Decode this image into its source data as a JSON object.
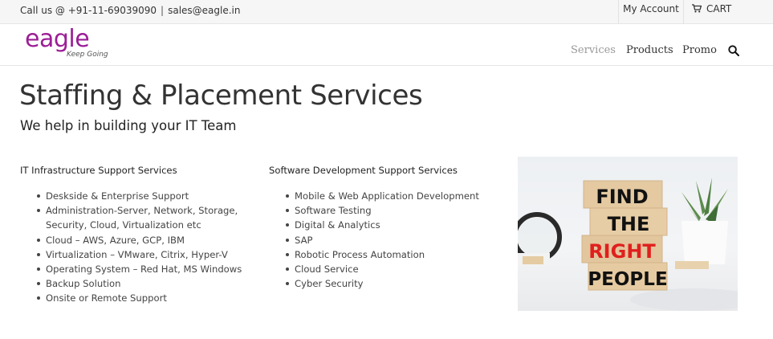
{
  "topbar": {
    "call": "Call us @ +91-11-69039090",
    "separator": "|",
    "email": "sales@eagle.in",
    "my_account": "My Account",
    "cart": "CART",
    "cart_icon": "cart-icon"
  },
  "header": {
    "logo_word": "eagle",
    "logo_tagline": "Keep Going",
    "nav": [
      "Services",
      "Products",
      "Promo"
    ],
    "search_icon": "search-icon",
    "colors": {
      "brand": "#9c1e96",
      "nav_active": "#999999"
    }
  },
  "page": {
    "title": "Staffing & Placement Services",
    "subtitle": "We help in building your IT Team"
  },
  "columns": [
    {
      "heading": "IT Infrastructure Support Services",
      "items": [
        "Deskside & Enterprise Support",
        "Administration-Server, Network, Storage, Security, Cloud, Virtualization etc",
        "Cloud – AWS, Azure, GCP, IBM",
        "Virtualization – VMware, Citrix, Hyper-V",
        "Operating System – Red Hat, MS Windows",
        "Backup Solution",
        "Onsite or Remote Support"
      ]
    },
    {
      "heading": "Software Development Support Services",
      "items": [
        "Mobile & Web Application Development",
        "Software Testing",
        "Digital & Analytics",
        "SAP",
        "Robotic Process Automation",
        "Cloud Service",
        "Cyber Security"
      ]
    }
  ],
  "image": {
    "blocks": [
      "FIND",
      "THE",
      "RIGHT",
      "PEOPLE"
    ],
    "colors": {
      "text": "#111111",
      "highlight": "#e0201e",
      "wood": "#e2c79f"
    }
  }
}
